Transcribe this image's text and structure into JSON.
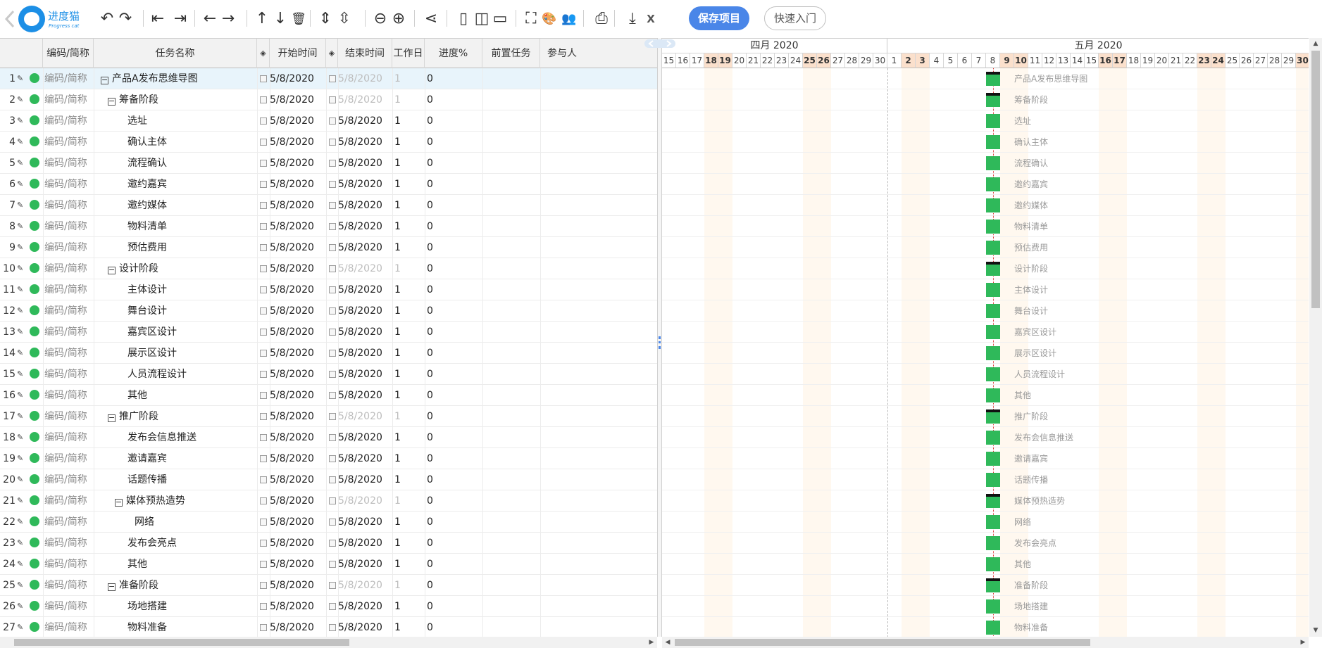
{
  "app": {
    "name": "进度猫",
    "tagline": "Progress cat",
    "save_label": "保存项目",
    "quick_label": "快速入门"
  },
  "toolbar_icons": [
    {
      "name": "undo-icon",
      "glyph": "↶"
    },
    {
      "name": "redo-icon",
      "glyph": "↷"
    },
    {
      "name": "outdent-icon",
      "glyph": "⇤"
    },
    {
      "name": "indent-icon",
      "glyph": "⇥"
    },
    {
      "name": "move-left-icon",
      "glyph": "←"
    },
    {
      "name": "move-right-icon",
      "glyph": "→"
    },
    {
      "name": "move-up-icon",
      "glyph": "↑"
    },
    {
      "name": "move-down-icon",
      "glyph": "↓"
    },
    {
      "name": "delete-icon",
      "glyph": "🗑"
    },
    {
      "name": "expand-all-icon",
      "glyph": "⇕"
    },
    {
      "name": "collapse-all-icon",
      "glyph": "⇳"
    },
    {
      "name": "zoom-out-icon",
      "glyph": "⊖"
    },
    {
      "name": "zoom-in-icon",
      "glyph": "⊕"
    },
    {
      "name": "critical-path-icon",
      "glyph": "⋖"
    },
    {
      "name": "view-grid-only-icon",
      "glyph": "▯"
    },
    {
      "name": "view-split-icon",
      "glyph": "◫"
    },
    {
      "name": "view-gantt-only-icon",
      "glyph": "▭"
    },
    {
      "name": "fullscreen-icon",
      "glyph": "⛶"
    },
    {
      "name": "palette-icon",
      "glyph": "🎨"
    },
    {
      "name": "users-icon",
      "glyph": "👥"
    },
    {
      "name": "print-icon",
      "glyph": "⎙"
    },
    {
      "name": "download-icon",
      "glyph": "⤓"
    },
    {
      "name": "excel-export-icon",
      "glyph": "X"
    }
  ],
  "columns": {
    "code": "编码/简称",
    "name": "任务名称",
    "start": "开始时间",
    "end": "结束时间",
    "workdays": "工作日",
    "progress": "进度%",
    "predecessor": "前置任务",
    "participants": "参与人"
  },
  "months": [
    {
      "label": "四月 2020"
    },
    {
      "label": "五月 2020"
    }
  ],
  "days": [
    {
      "d": "15",
      "we": false
    },
    {
      "d": "16",
      "we": false
    },
    {
      "d": "17",
      "we": false
    },
    {
      "d": "18",
      "we": true
    },
    {
      "d": "19",
      "we": true
    },
    {
      "d": "20",
      "we": false
    },
    {
      "d": "21",
      "we": false
    },
    {
      "d": "22",
      "we": false
    },
    {
      "d": "23",
      "we": false
    },
    {
      "d": "24",
      "we": false
    },
    {
      "d": "25",
      "we": true
    },
    {
      "d": "26",
      "we": true
    },
    {
      "d": "27",
      "we": false
    },
    {
      "d": "28",
      "we": false
    },
    {
      "d": "29",
      "we": false
    },
    {
      "d": "30",
      "we": false
    },
    {
      "d": "1",
      "we": false
    },
    {
      "d": "2",
      "we": true
    },
    {
      "d": "3",
      "we": true
    },
    {
      "d": "4",
      "we": false
    },
    {
      "d": "5",
      "we": false
    },
    {
      "d": "6",
      "we": false
    },
    {
      "d": "7",
      "we": false
    },
    {
      "d": "8",
      "we": false
    },
    {
      "d": "9",
      "we": true
    },
    {
      "d": "10",
      "we": true
    },
    {
      "d": "11",
      "we": false
    },
    {
      "d": "12",
      "we": false
    },
    {
      "d": "13",
      "we": false
    },
    {
      "d": "14",
      "we": false
    },
    {
      "d": "15",
      "we": false
    },
    {
      "d": "16",
      "we": true
    },
    {
      "d": "17",
      "we": true
    },
    {
      "d": "18",
      "we": false
    },
    {
      "d": "19",
      "we": false
    },
    {
      "d": "20",
      "we": false
    },
    {
      "d": "21",
      "we": false
    },
    {
      "d": "22",
      "we": false
    },
    {
      "d": "23",
      "we": true
    },
    {
      "d": "24",
      "we": true
    },
    {
      "d": "25",
      "we": false
    },
    {
      "d": "26",
      "we": false
    },
    {
      "d": "27",
      "we": false
    },
    {
      "d": "28",
      "we": false
    },
    {
      "d": "29",
      "we": false
    },
    {
      "d": "30",
      "we": true
    }
  ],
  "tasks": [
    {
      "n": "1",
      "code": "编码/简称",
      "name": "产品A发布思维导图",
      "level": 0,
      "summary": true,
      "start": "5/8/2020",
      "end": "5/8/2020",
      "wd": "1",
      "pg": "0"
    },
    {
      "n": "2",
      "code": "编码/简称",
      "name": "筹备阶段",
      "level": 1,
      "summary": true,
      "start": "5/8/2020",
      "end": "5/8/2020",
      "wd": "1",
      "pg": "0"
    },
    {
      "n": "3",
      "code": "编码/简称",
      "name": "选址",
      "level": 2,
      "summary": false,
      "start": "5/8/2020",
      "end": "5/8/2020",
      "wd": "1",
      "pg": "0"
    },
    {
      "n": "4",
      "code": "编码/简称",
      "name": "确认主体",
      "level": 2,
      "summary": false,
      "start": "5/8/2020",
      "end": "5/8/2020",
      "wd": "1",
      "pg": "0"
    },
    {
      "n": "5",
      "code": "编码/简称",
      "name": "流程确认",
      "level": 2,
      "summary": false,
      "start": "5/8/2020",
      "end": "5/8/2020",
      "wd": "1",
      "pg": "0"
    },
    {
      "n": "6",
      "code": "编码/简称",
      "name": "邀约嘉宾",
      "level": 2,
      "summary": false,
      "start": "5/8/2020",
      "end": "5/8/2020",
      "wd": "1",
      "pg": "0"
    },
    {
      "n": "7",
      "code": "编码/简称",
      "name": "邀约媒体",
      "level": 2,
      "summary": false,
      "start": "5/8/2020",
      "end": "5/8/2020",
      "wd": "1",
      "pg": "0"
    },
    {
      "n": "8",
      "code": "编码/简称",
      "name": "物料清单",
      "level": 2,
      "summary": false,
      "start": "5/8/2020",
      "end": "5/8/2020",
      "wd": "1",
      "pg": "0"
    },
    {
      "n": "9",
      "code": "编码/简称",
      "name": "预估费用",
      "level": 2,
      "summary": false,
      "start": "5/8/2020",
      "end": "5/8/2020",
      "wd": "1",
      "pg": "0"
    },
    {
      "n": "10",
      "code": "编码/简称",
      "name": "设计阶段",
      "level": 1,
      "summary": true,
      "start": "5/8/2020",
      "end": "5/8/2020",
      "wd": "1",
      "pg": "0"
    },
    {
      "n": "11",
      "code": "编码/简称",
      "name": "主体设计",
      "level": 2,
      "summary": false,
      "start": "5/8/2020",
      "end": "5/8/2020",
      "wd": "1",
      "pg": "0"
    },
    {
      "n": "12",
      "code": "编码/简称",
      "name": "舞台设计",
      "level": 2,
      "summary": false,
      "start": "5/8/2020",
      "end": "5/8/2020",
      "wd": "1",
      "pg": "0"
    },
    {
      "n": "13",
      "code": "编码/简称",
      "name": "嘉宾区设计",
      "level": 2,
      "summary": false,
      "start": "5/8/2020",
      "end": "5/8/2020",
      "wd": "1",
      "pg": "0"
    },
    {
      "n": "14",
      "code": "编码/简称",
      "name": "展示区设计",
      "level": 2,
      "summary": false,
      "start": "5/8/2020",
      "end": "5/8/2020",
      "wd": "1",
      "pg": "0"
    },
    {
      "n": "15",
      "code": "编码/简称",
      "name": "人员流程设计",
      "level": 2,
      "summary": false,
      "start": "5/8/2020",
      "end": "5/8/2020",
      "wd": "1",
      "pg": "0"
    },
    {
      "n": "16",
      "code": "编码/简称",
      "name": "其他",
      "level": 2,
      "summary": false,
      "start": "5/8/2020",
      "end": "5/8/2020",
      "wd": "1",
      "pg": "0"
    },
    {
      "n": "17",
      "code": "编码/简称",
      "name": "推广阶段",
      "level": 1,
      "summary": true,
      "start": "5/8/2020",
      "end": "5/8/2020",
      "wd": "1",
      "pg": "0"
    },
    {
      "n": "18",
      "code": "编码/简称",
      "name": "发布会信息推送",
      "level": 2,
      "summary": false,
      "start": "5/8/2020",
      "end": "5/8/2020",
      "wd": "1",
      "pg": "0"
    },
    {
      "n": "19",
      "code": "编码/简称",
      "name": "邀请嘉宾",
      "level": 2,
      "summary": false,
      "start": "5/8/2020",
      "end": "5/8/2020",
      "wd": "1",
      "pg": "0"
    },
    {
      "n": "20",
      "code": "编码/简称",
      "name": "话题传播",
      "level": 2,
      "summary": false,
      "start": "5/8/2020",
      "end": "5/8/2020",
      "wd": "1",
      "pg": "0"
    },
    {
      "n": "21",
      "code": "编码/简称",
      "name": "媒体预热造势",
      "level": 2,
      "summary": true,
      "start": "5/8/2020",
      "end": "5/8/2020",
      "wd": "1",
      "pg": "0"
    },
    {
      "n": "22",
      "code": "编码/简称",
      "name": "网络",
      "level": 3,
      "summary": false,
      "start": "5/8/2020",
      "end": "5/8/2020",
      "wd": "1",
      "pg": "0"
    },
    {
      "n": "23",
      "code": "编码/简称",
      "name": "发布会亮点",
      "level": 2,
      "summary": false,
      "start": "5/8/2020",
      "end": "5/8/2020",
      "wd": "1",
      "pg": "0"
    },
    {
      "n": "24",
      "code": "编码/简称",
      "name": "其他",
      "level": 2,
      "summary": false,
      "start": "5/8/2020",
      "end": "5/8/2020",
      "wd": "1",
      "pg": "0"
    },
    {
      "n": "25",
      "code": "编码/简称",
      "name": "准备阶段",
      "level": 1,
      "summary": true,
      "start": "5/8/2020",
      "end": "5/8/2020",
      "wd": "1",
      "pg": "0"
    },
    {
      "n": "26",
      "code": "编码/简称",
      "name": "场地搭建",
      "level": 2,
      "summary": false,
      "start": "5/8/2020",
      "end": "5/8/2020",
      "wd": "1",
      "pg": "0"
    },
    {
      "n": "27",
      "code": "编码/简称",
      "name": "物料准备",
      "level": 2,
      "summary": false,
      "start": "5/8/2020",
      "end": "5/8/2020",
      "wd": "1",
      "pg": "0"
    }
  ],
  "gantt": {
    "bar_day": "8",
    "bar_month": "五月 2020"
  },
  "colors": {
    "accent": "#4a86e8",
    "brand": "#1c8fe6",
    "bar": "#2fb95a",
    "weekend": "#fbe0cc"
  }
}
